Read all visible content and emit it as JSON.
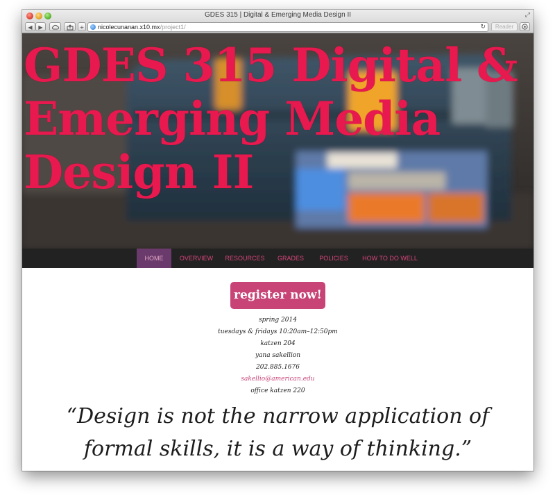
{
  "browser": {
    "window_title": "GDES 315 | Digital & Emerging Media Design II",
    "url_host": "nicolecunanan.x10.mx",
    "url_path": "/project1/",
    "reader_label": "Reader"
  },
  "hero": {
    "title": "GDES 315 Digital & Emerging Media Design II"
  },
  "nav": {
    "items": [
      "HOME",
      "OVERVIEW",
      "RESOURCES",
      "GRADES",
      "POLICIES",
      "HOW TO DO WELL"
    ],
    "active_index": 0
  },
  "main": {
    "register_label": "register now!",
    "info": {
      "term": "spring 2014",
      "schedule": "tuesdays & fridays 10:20am–12:50pm",
      "room": "katzen 204",
      "instructor": "yana sakellion",
      "phone": "202.885.1676",
      "email": "sakellio@american.edu",
      "office": "office katzen 220"
    },
    "quote": "“Design is not the narrow application of formal skills, it is a way of thinking.”"
  },
  "colors": {
    "accent": "#c84477",
    "hero_title": "#e8194e",
    "nav_bg": "#222222",
    "nav_active": "#6a3a6c"
  }
}
